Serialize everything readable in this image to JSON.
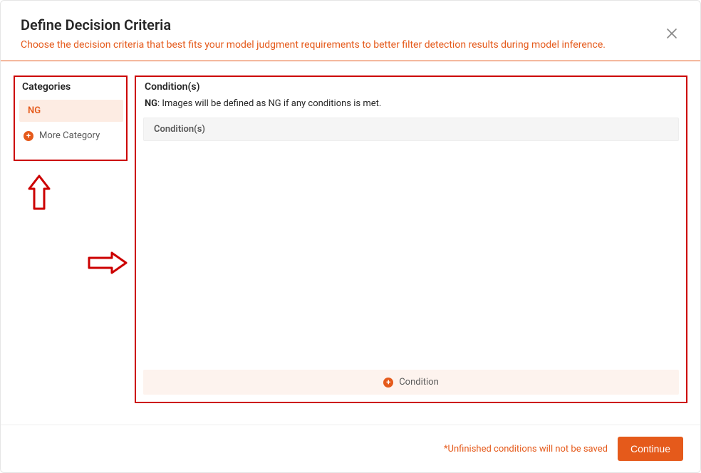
{
  "header": {
    "title": "Define Decision Criteria",
    "subtitle": "Choose the decision criteria that best fits your model judgment requirements to better filter detection results during model inference."
  },
  "sidebar": {
    "title": "Categories",
    "active_category": "NG",
    "more_label": "More Category"
  },
  "main": {
    "title": "Condition(s)",
    "desc_bold": "NG",
    "desc_rest": ": Images will be defined as NG if any conditions is met.",
    "table_header": "Condition(s)",
    "add_condition_label": "Condition"
  },
  "footer": {
    "note": "*Unfinished conditions will not be saved",
    "continue_label": "Continue"
  }
}
